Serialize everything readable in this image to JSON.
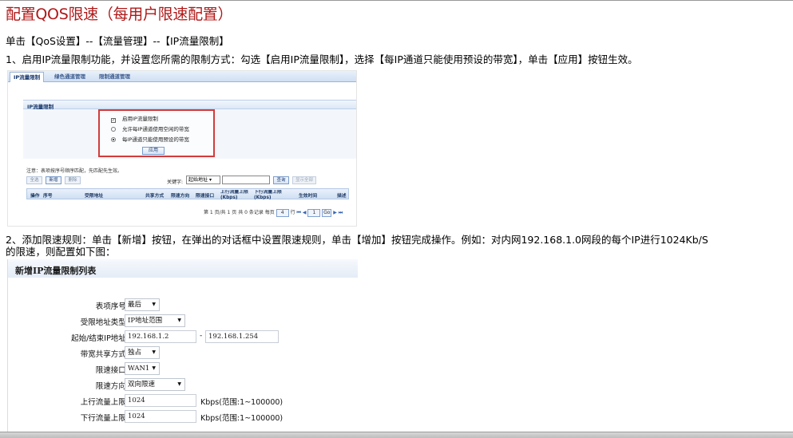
{
  "title": "配置QOS限速（每用户限速配置）",
  "instructions": {
    "breadcrumb": "单击【QoS设置】--【流量管理】--【IP流量限制】",
    "step1": "1、启用IP流量限制功能，并设置您所需的限制方式：勾选【启用IP流量限制】，选择【每IP通道只能使用预设的带宽】，单击【应用】按钮生效。",
    "step2_line1": "2、添加限速规则：单击【新增】按钮，在弹出的对话框中设置限速规则，单击【增加】按钮完成操作。例如：对内网192.168.1.0网段的每个IP进行1024Kb/S",
    "step2_line2": "的限速，则配置如下图："
  },
  "shot1": {
    "tabs": [
      "IP流量限制",
      "绿色通道管理",
      "限制通道管理"
    ],
    "panel_title": "IP流量限制",
    "options": {
      "enable": "启用IP流量限制",
      "allow_idle": "允许每IP通道使用空闲的带宽",
      "preset_only": "每IP通道只能使用预设的带宽"
    },
    "apply_label": "应用",
    "note": "注意：表项按序号顺序匹配，先匹配先生效。",
    "buttons": {
      "select_all": "全选",
      "add": "新增",
      "delete": "删除",
      "search": "查询",
      "show_all": "显示全部"
    },
    "keyword_label": "关键字:",
    "keyword_select": "起始地址",
    "columns": [
      "操作",
      "序号",
      "受限地址",
      "共享方式",
      "限速方向",
      "限速接口",
      "上行流量上限(Kbps)",
      "下行流量上限(Kbps)",
      "生效时间",
      "描述"
    ],
    "pager": {
      "summary": "第 1 页/共 1 页 共 0 条记录 每页",
      "per_page": "4",
      "unit": "行",
      "page": "1",
      "go": "Go"
    }
  },
  "shot2": {
    "title": "新增IP流量限制列表",
    "fields": [
      {
        "label": "表项序号:",
        "value": "最后"
      },
      {
        "label": "受限地址类型:",
        "value": "IP地址范围"
      },
      {
        "label": "起始/结束IP地址:",
        "start": "192.168.1.2",
        "end": "192.168.1.254"
      },
      {
        "label": "带宽共享方式:",
        "value": "独占"
      },
      {
        "label": "限速接口:",
        "value": "WAN1"
      },
      {
        "label": "限速方向:",
        "value": "双向限速"
      },
      {
        "label": "上行流量上限:",
        "value": "1024",
        "unit": "Kbps(范围:1~100000)"
      },
      {
        "label": "下行流量上限:",
        "value": "1024",
        "unit": "Kbps(范围:1~100000)"
      }
    ]
  }
}
